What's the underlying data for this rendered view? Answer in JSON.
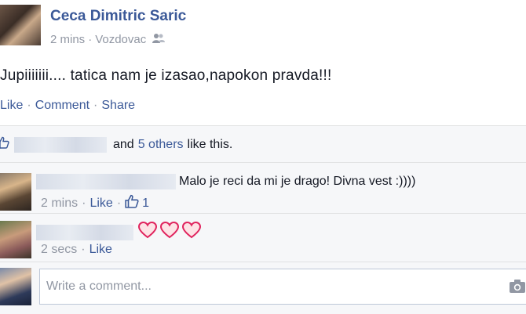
{
  "post": {
    "author": "Ceca Dimitric Saric",
    "time": "2 mins",
    "location": "Vozdovac",
    "audience_icon": "friends-icon",
    "text": "Jupiiiiiii.... tatica nam je izasao,napokon pravda!!!"
  },
  "actions": {
    "like": "Like",
    "comment": "Comment",
    "share": "Share"
  },
  "likes": {
    "and": "and",
    "others": "5 others",
    "suffix": "like this."
  },
  "comments": [
    {
      "text": "Malo je reci da mi je drago! Divna vest :))))",
      "time": "2 mins",
      "like": "Like",
      "like_count": "1"
    },
    {
      "hearts": 3,
      "time": "2 secs",
      "like": "Like"
    }
  ],
  "composer": {
    "placeholder": "Write a comment..."
  },
  "colors": {
    "link": "#3b5998",
    "meta": "#9197a3",
    "heart": "#e0245e"
  }
}
